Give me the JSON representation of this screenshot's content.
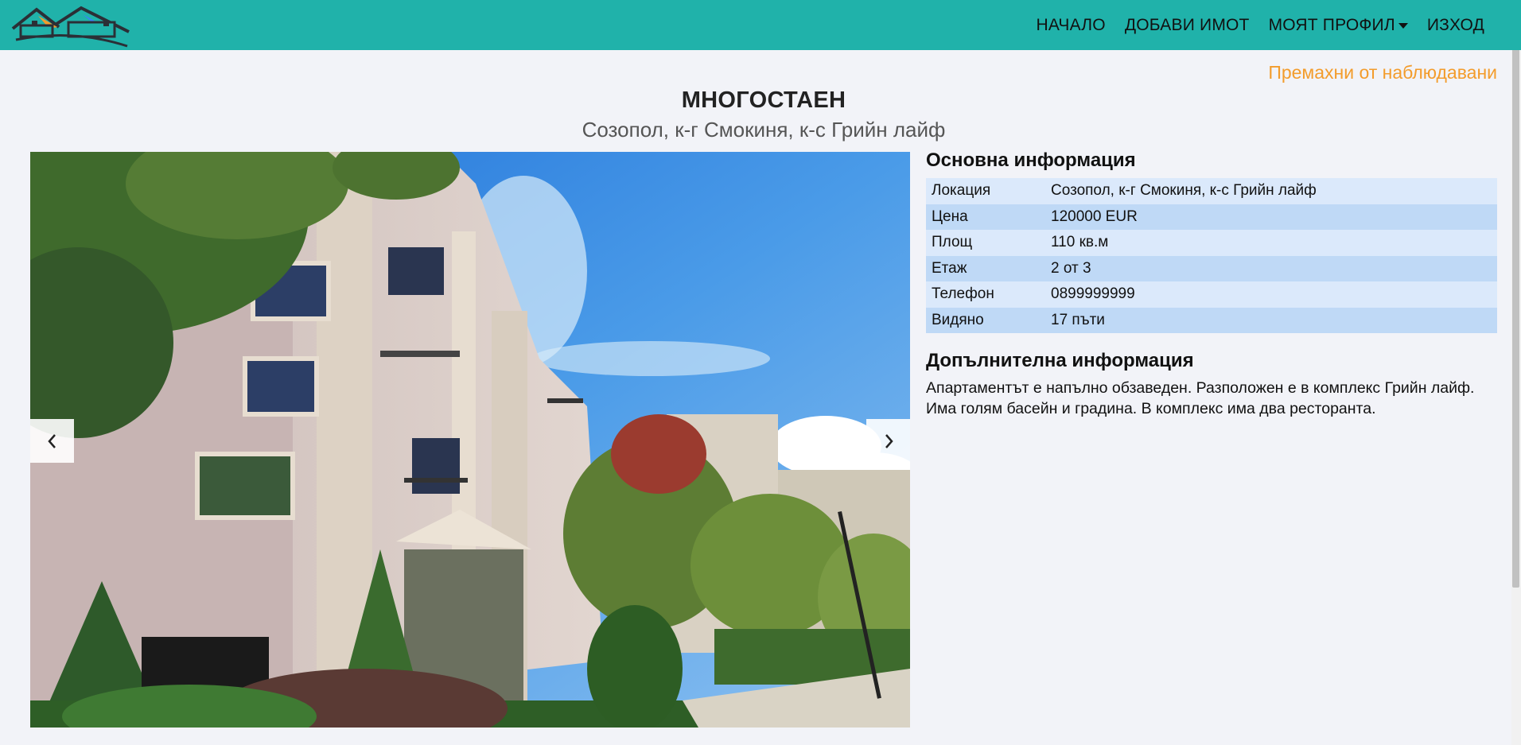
{
  "nav": {
    "logo_name": "house-logo",
    "items": [
      {
        "label": "НАЧАЛО"
      },
      {
        "label": "ДОБАВИ ИМОТ"
      },
      {
        "label": "МОЯТ ПРОФИЛ"
      },
      {
        "label": "ИЗХОД"
      }
    ]
  },
  "watch_link": "Премахни от наблюдавани",
  "property": {
    "title": "МНОГОСТАЕН",
    "subtitle": "Созопол, к-г Смокиня, к-с Грийн лайф"
  },
  "basic_info": {
    "heading": "Основна информация",
    "rows": [
      {
        "label": "Локация",
        "value": "Созопол, к-г Смокиня, к-с Грийн лайф"
      },
      {
        "label": "Цена",
        "value": "120000 EUR"
      },
      {
        "label": "Площ",
        "value": "110 кв.м"
      },
      {
        "label": "Етаж",
        "value": "2 от 3"
      },
      {
        "label": "Телефон",
        "value": "0899999999"
      },
      {
        "label": "Видяно",
        "value": "17 пъти"
      }
    ]
  },
  "extra_info": {
    "heading": "Допълнителна информация",
    "text": "Апартаментът е напълно обзаведен. Разположен е в комплекс Грийн лайф. Има голям басейн и градина. В комплекс има два ресторанта."
  },
  "colors": {
    "navbar": "#20b2aa",
    "accent_link": "#f39c2c",
    "table_row_light": "#dbe9fb",
    "table_row_dark": "#bfd9f6"
  }
}
